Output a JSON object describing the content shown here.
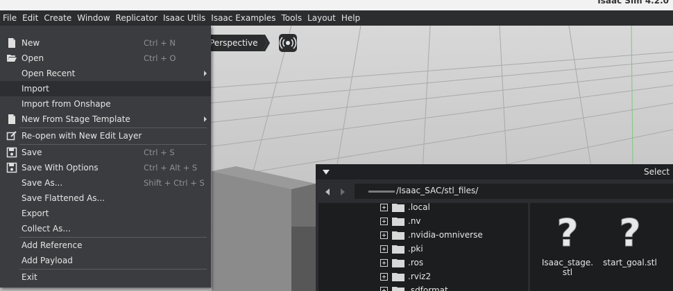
{
  "window": {
    "title": "Isaac Sim 4.2.0"
  },
  "menubar": {
    "items": [
      "File",
      "Edit",
      "Create",
      "Window",
      "Replicator",
      "Isaac Utils",
      "Isaac Examples",
      "Tools",
      "Layout",
      "Help"
    ]
  },
  "viewport": {
    "camera_label": "Perspective"
  },
  "file_menu": {
    "items": [
      {
        "label": "New",
        "shortcut": "Ctrl + N",
        "icon": "new-file-icon"
      },
      {
        "label": "Open",
        "shortcut": "Ctrl + O",
        "icon": "folder-open-icon"
      },
      {
        "label": "Open Recent",
        "shortcut": "",
        "submenu": true
      },
      {
        "label": "Import",
        "shortcut": "",
        "highlight": true
      },
      {
        "label": "Import from Onshape",
        "shortcut": ""
      },
      {
        "label": "New From Stage Template",
        "shortcut": "",
        "submenu": true,
        "icon": "new-file-icon"
      },
      {
        "label": "Re-open with New Edit Layer",
        "shortcut": "",
        "icon": "edit-layer-icon"
      },
      {
        "label": "Save",
        "shortcut": "Ctrl + S",
        "icon": "save-icon"
      },
      {
        "label": "Save With Options",
        "shortcut": "Ctrl + Alt + S",
        "icon": "save-icon"
      },
      {
        "label": "Save As...",
        "shortcut": "Shift + Ctrl + S"
      },
      {
        "label": "Save Flattened As...",
        "shortcut": ""
      },
      {
        "label": "Export",
        "shortcut": ""
      },
      {
        "label": "Collect As...",
        "shortcut": ""
      },
      {
        "label": "Add Reference",
        "shortcut": ""
      },
      {
        "label": "Add Payload",
        "shortcut": ""
      },
      {
        "label": "Exit",
        "shortcut": ""
      }
    ]
  },
  "file_picker": {
    "title": "Select F",
    "path": "/Isaac_SAC/stl_files/",
    "folders": [
      ".local",
      ".nv",
      ".nvidia-omniverse",
      ".pki",
      ".ros",
      ".rviz2",
      ".sdformat"
    ],
    "files": [
      "Isaac_stage.\nstl",
      "start_goal.stl"
    ]
  },
  "colors": {
    "menu_bg": "#3a3c3f",
    "menubar_bg": "#2b2d2f",
    "highlight": "#2c2e31",
    "picker_bg": "#1c1d1f"
  }
}
